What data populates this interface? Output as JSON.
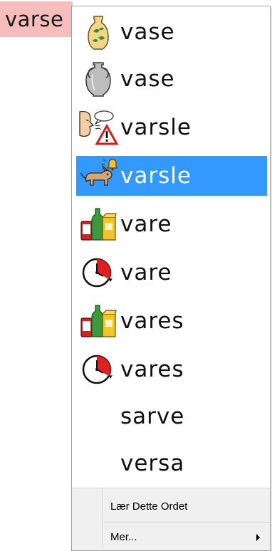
{
  "typed_word": "varse",
  "suggestions": [
    {
      "word": "vase",
      "icon": "vase-with-leaves-icon"
    },
    {
      "word": "vase",
      "icon": "grey-amphora-vase-icon"
    },
    {
      "word": "varsle",
      "icon": "warning-speech-icon"
    },
    {
      "word": "varsle",
      "icon": "dog-alert-bell-icon"
    },
    {
      "word": "vare",
      "icon": "goods-products-icon"
    },
    {
      "word": "vare",
      "icon": "clock-duration-icon"
    },
    {
      "word": "vares",
      "icon": "goods-products-icon"
    },
    {
      "word": "vares",
      "icon": "clock-duration-icon"
    },
    {
      "word": "sarve",
      "icon": ""
    },
    {
      "word": "versa",
      "icon": ""
    }
  ],
  "selected_index": 3,
  "menu": {
    "learn_word": "Lær Dette Ordet",
    "more": "Mer..."
  },
  "colors": {
    "selection": "#3399ff",
    "typed_highlight": "#f7bcbc"
  }
}
